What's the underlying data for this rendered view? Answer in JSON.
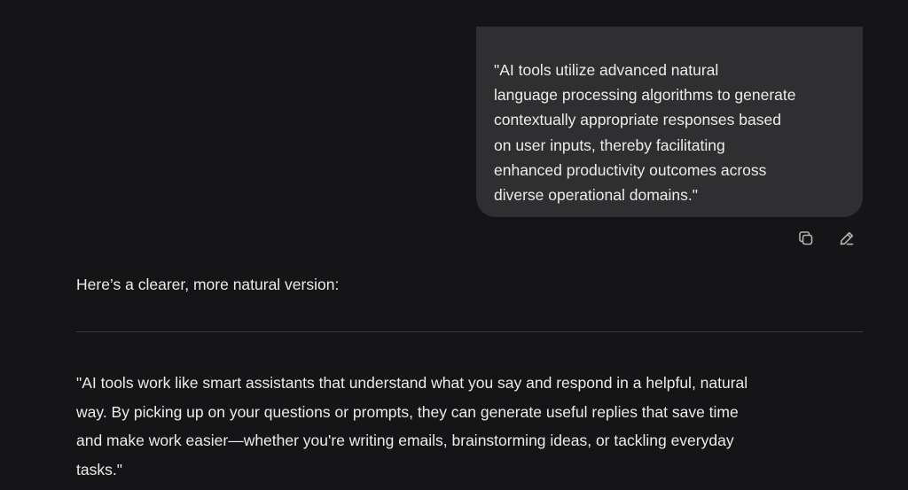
{
  "user_message": {
    "lines": [
      "\"AI tools utilize advanced natural",
      "language processing algorithms to generate",
      "contextually appropriate responses based",
      "on user inputs, thereby facilitating",
      "enhanced productivity outcomes across",
      "diverse operational domains.\""
    ],
    "actions": {
      "copy_icon": "copy-icon",
      "edit_icon": "edit-icon"
    }
  },
  "assistant_message": {
    "intro": "Here’s a clearer, more natural version:",
    "rewrite_lines": [
      "\"AI tools work like smart assistants that understand what you say and respond in a helpful, natural",
      "way. By picking up on your questions or prompts, they can generate useful replies that save time",
      "and make work easier—whether you're writing emails, brainstorming ideas, or tackling everyday",
      "tasks.\""
    ]
  },
  "colors": {
    "background": "#151416",
    "user_bubble": "#2f2f31",
    "text": "#ececec",
    "icon": "#b4b4b4",
    "divider": "#3b3a3e"
  }
}
